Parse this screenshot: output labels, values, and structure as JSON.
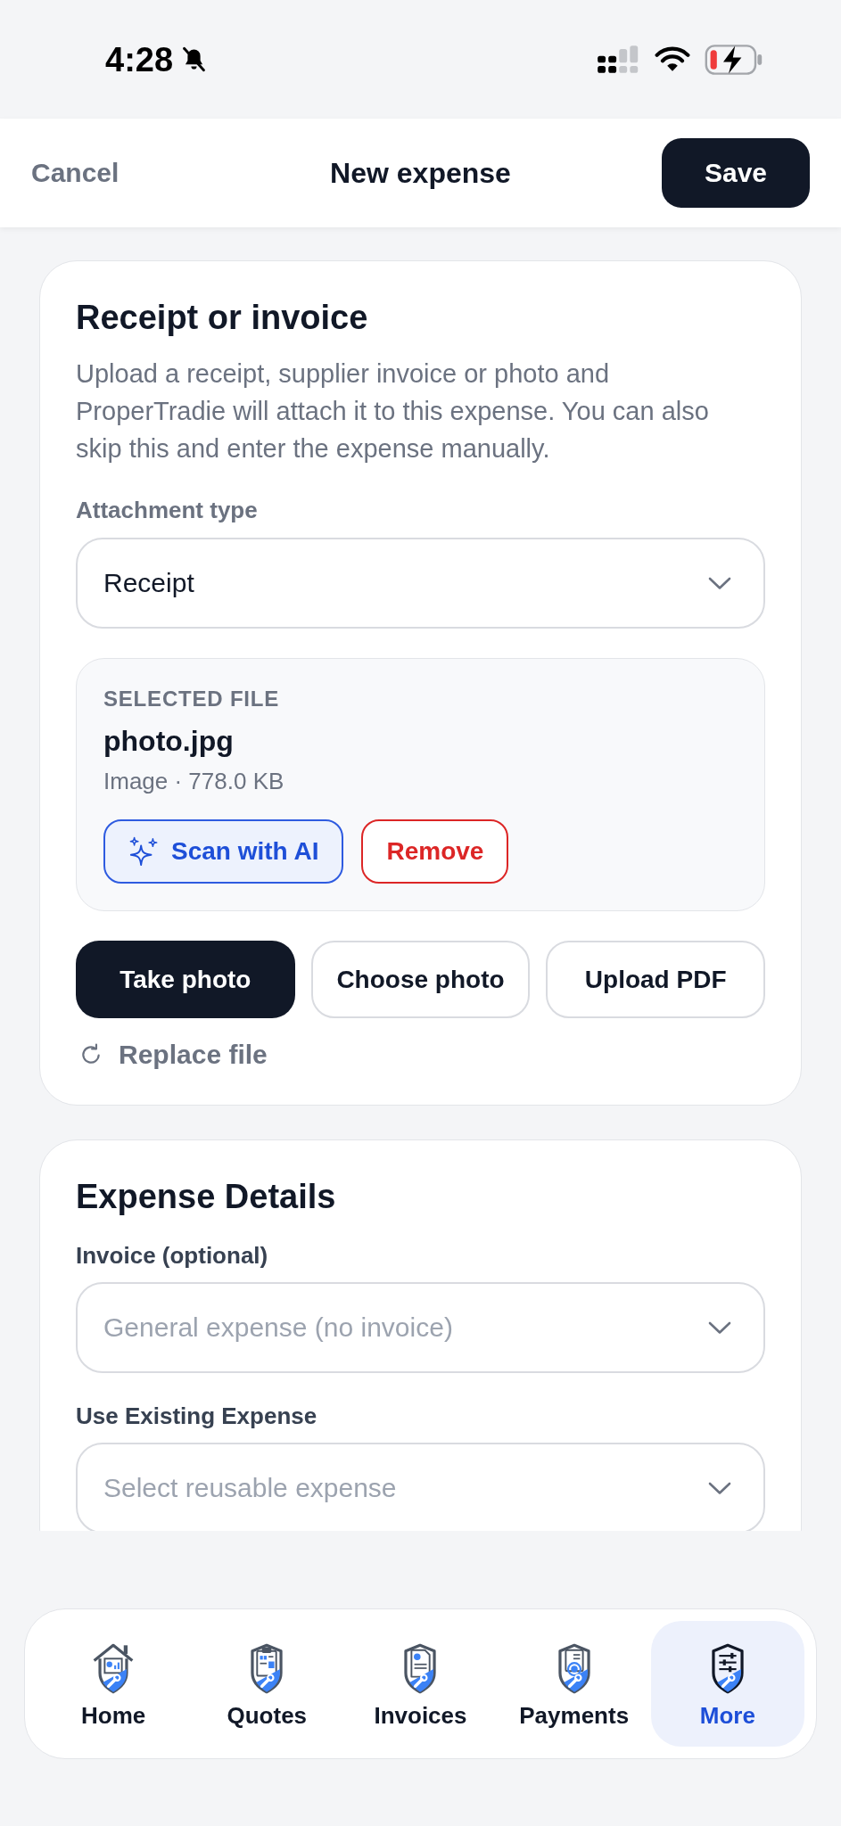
{
  "status_bar": {
    "time": "4:28"
  },
  "header": {
    "cancel": "Cancel",
    "title": "New expense",
    "save": "Save"
  },
  "receipt_card": {
    "title": "Receipt or invoice",
    "description": "Upload a receipt, supplier invoice or photo and ProperTradie will attach it to this expense. You can also skip this and enter the expense manually.",
    "attachment_type": {
      "label": "Attachment type",
      "value": "Receipt"
    },
    "selected_file": {
      "caption": "SELECTED FILE",
      "name": "photo.jpg",
      "meta": "Image · 778.0 KB",
      "actions": [
        {
          "label": "Scan with AI",
          "kind": "ai"
        },
        {
          "label": "Remove",
          "kind": "danger"
        }
      ]
    },
    "source_buttons": [
      {
        "label": "Take photo",
        "kind": "primary"
      },
      {
        "label": "Choose photo",
        "kind": "secondary"
      },
      {
        "label": "Upload PDF",
        "kind": "secondary"
      }
    ],
    "replace_link": "Replace file"
  },
  "details_card": {
    "title": "Expense Details",
    "fields": [
      {
        "label": "Invoice (optional)",
        "placeholder": "General expense (no invoice)"
      },
      {
        "label": "Use Existing Expense",
        "placeholder": "Select reusable expense"
      }
    ]
  },
  "tab_bar": {
    "tabs": [
      {
        "label": "Home",
        "selected": false
      },
      {
        "label": "Quotes",
        "selected": false
      },
      {
        "label": "Invoices",
        "selected": false
      },
      {
        "label": "Payments",
        "selected": false
      },
      {
        "label": "More",
        "selected": true
      }
    ]
  }
}
